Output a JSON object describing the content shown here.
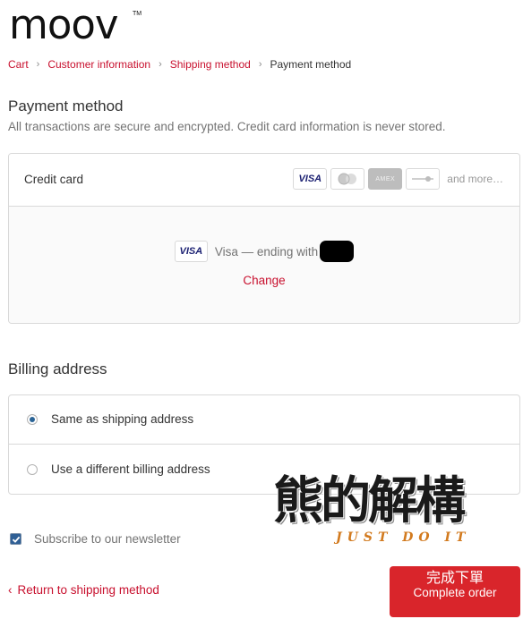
{
  "brand": {
    "logo_text": "moov",
    "trademark": "TM"
  },
  "breadcrumb": {
    "items": [
      {
        "label": "Cart",
        "current": false
      },
      {
        "label": "Customer information",
        "current": false
      },
      {
        "label": "Shipping method",
        "current": false
      },
      {
        "label": "Payment method",
        "current": true
      }
    ]
  },
  "payment": {
    "title": "Payment method",
    "subtitle": "All transactions are secure and encrypted. Credit card information is never stored.",
    "method_label": "Credit card",
    "card_icons": [
      {
        "name": "visa-icon",
        "text": "VISA"
      },
      {
        "name": "mastercard-icon",
        "text": ""
      },
      {
        "name": "amex-icon",
        "text": "AMEX"
      },
      {
        "name": "generic-card-icon",
        "text": ""
      }
    ],
    "and_more": "and more…",
    "saved_card": {
      "brand_badge": "VISA",
      "text": "Visa — ending with",
      "change_label": "Change"
    }
  },
  "billing": {
    "title": "Billing address",
    "options": [
      {
        "label": "Same as shipping address",
        "selected": true
      },
      {
        "label": "Use a different billing address",
        "selected": false
      }
    ]
  },
  "newsletter": {
    "label": "Subscribe to our newsletter",
    "checked": true
  },
  "footer": {
    "return_label": "Return to shipping method",
    "return_chevron": "‹",
    "complete_label_cn": "完成下單",
    "complete_label_en": "Complete order"
  },
  "watermark": {
    "text_cn": "熊的解構",
    "text_en": "JUST DO IT"
  },
  "colors": {
    "accent": "#c8102e",
    "button": "#d9252b",
    "radio_selected": "#2a6496"
  }
}
